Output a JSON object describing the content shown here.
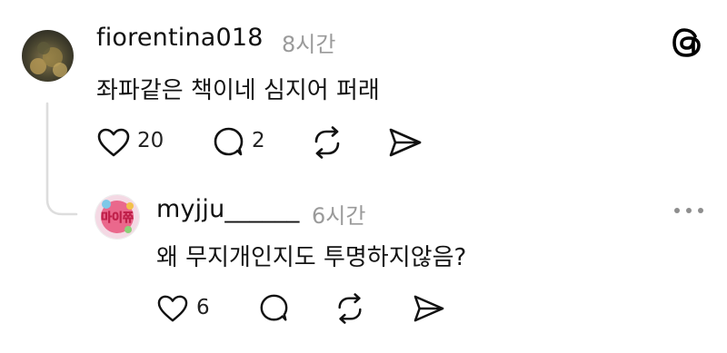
{
  "post": {
    "username": "fiorentina018",
    "time": "8시간",
    "text": "좌파같은 책이네 심지어 퍼래",
    "likes": "20",
    "replies": "2"
  },
  "reply": {
    "username": "myjju______",
    "time": "6시간",
    "text": "왜 무지개인지도 투명하지않음?",
    "likes": "6",
    "avatar_text": "마이쮸"
  },
  "icons": {
    "logo": "threads-logo-icon",
    "more": "more-horizontal-icon",
    "like": "heart-icon",
    "comment": "comment-bubble-icon",
    "repost": "repost-icon",
    "share": "send-icon"
  },
  "colors": {
    "text": "#111111",
    "secondary": "#9a9a9a",
    "line": "#dddddd"
  }
}
